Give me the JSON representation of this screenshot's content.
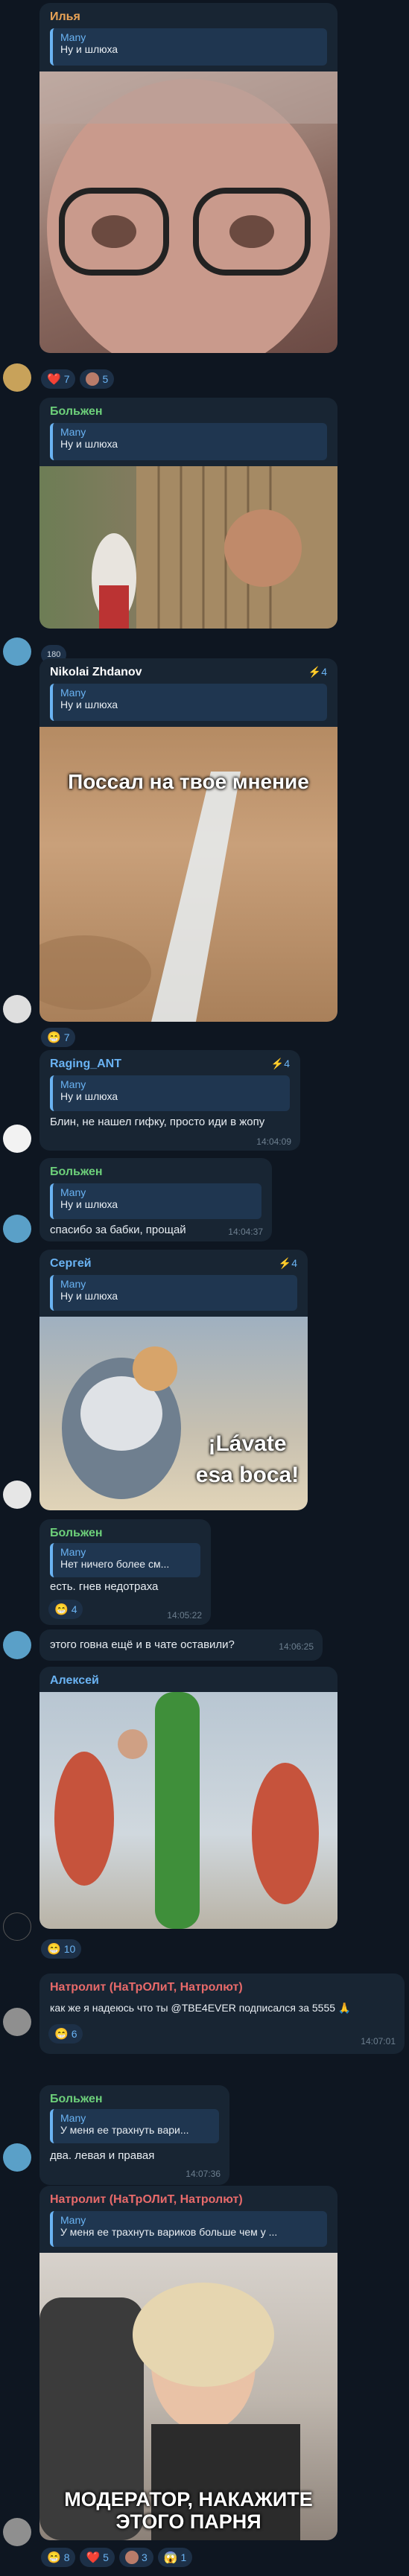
{
  "colors": {
    "bg": "#0e1621",
    "bubble": "#182533",
    "accent": "#6ab3f3"
  },
  "messages": [
    {
      "sender": "Илья",
      "sender_color": "#e9a356",
      "quote_name": "Many",
      "quote_text": "Ну и шлюха",
      "reactions": [
        {
          "icon": "heart-icon",
          "emoji": "❤️",
          "count": "7"
        },
        {
          "icon": "avatar-icon",
          "emoji": "",
          "count": "5"
        }
      ]
    },
    {
      "sender": "Больжен",
      "sender_color": "#6dd07a",
      "quote_name": "Many",
      "quote_text": "Ну и шлюха",
      "reactions_label": "180"
    },
    {
      "sender": "Nikolai Zhdanov",
      "sender_color": "#ffffff",
      "boost": "4",
      "quote_name": "Many",
      "quote_text": "Ну и шлюха",
      "image_caption": "Поссал на твое мнение",
      "reactions": [
        {
          "icon": "smile-icon",
          "emoji": "😁",
          "count": "7"
        }
      ]
    },
    {
      "sender": "Raging_ANT",
      "sender_color": "#6ab3f3",
      "boost": "4",
      "quote_name": "Many",
      "quote_text": "Ну и шлюха",
      "text": "Блин, не нашел гифку, просто иди в жопу",
      "time": "14:04:09"
    },
    {
      "sender": "Больжен",
      "sender_color": "#6dd07a",
      "quote_name": "Many",
      "quote_text": "Ну и шлюха",
      "text": "спасибо за бабки, прощай",
      "time": "14:04:37"
    },
    {
      "sender": "Сергей",
      "sender_color": "#6ab3f3",
      "boost": "4",
      "quote_name": "Many",
      "quote_text": "Ну и шлюха",
      "image_caption": "¡Lávate esa boca!"
    },
    {
      "sender": "Больжен",
      "sender_color": "#6dd07a",
      "quote_name": "Many",
      "quote_text": "Нет ничего более см...",
      "text": "есть. гнев недотраха",
      "time": "14:05:22",
      "reactions": [
        {
          "icon": "smile-icon",
          "emoji": "😁",
          "count": "4"
        }
      ]
    },
    {
      "text": "этого говна ещё и в чате оставили?",
      "time": "14:06:25"
    },
    {
      "sender": "Алексей",
      "sender_color": "#6ab3f3",
      "reactions": [
        {
          "icon": "smile-icon",
          "emoji": "😁",
          "count": "10"
        }
      ]
    },
    {
      "sender": "Натролит (НаТрОЛиТ, Натролют)",
      "sender_color": "#e86a6a",
      "text": "как же я надеюсь что ты @TBE4EVER подписался за 5555 🙏",
      "time": "14:07:01",
      "reactions": [
        {
          "icon": "smile-icon",
          "emoji": "😁",
          "count": "6"
        }
      ]
    },
    {
      "sender": "Больжен",
      "sender_color": "#6dd07a",
      "quote_name": "Many",
      "quote_text": "У меня ее трахнуть вари...",
      "text": "два. левая и правая",
      "time": "14:07:36"
    },
    {
      "sender": "Натролит (НаТрОЛиТ, Натролют)",
      "sender_color": "#e86a6a",
      "quote_name": "Many",
      "quote_text": "У меня ее трахнуть вариков больше чем у ...",
      "image_caption": "МОДЕРАТОР, НАКАЖИТЕ ЭТОГО ПАРНЯ",
      "reactions": [
        {
          "icon": "smile-icon",
          "emoji": "😁",
          "count": "8"
        },
        {
          "icon": "heart-icon",
          "emoji": "❤️",
          "count": "5"
        },
        {
          "icon": "avatar-icon",
          "emoji": "",
          "count": "3"
        },
        {
          "icon": "scream-icon",
          "emoji": "😱",
          "count": "1"
        }
      ]
    }
  ]
}
